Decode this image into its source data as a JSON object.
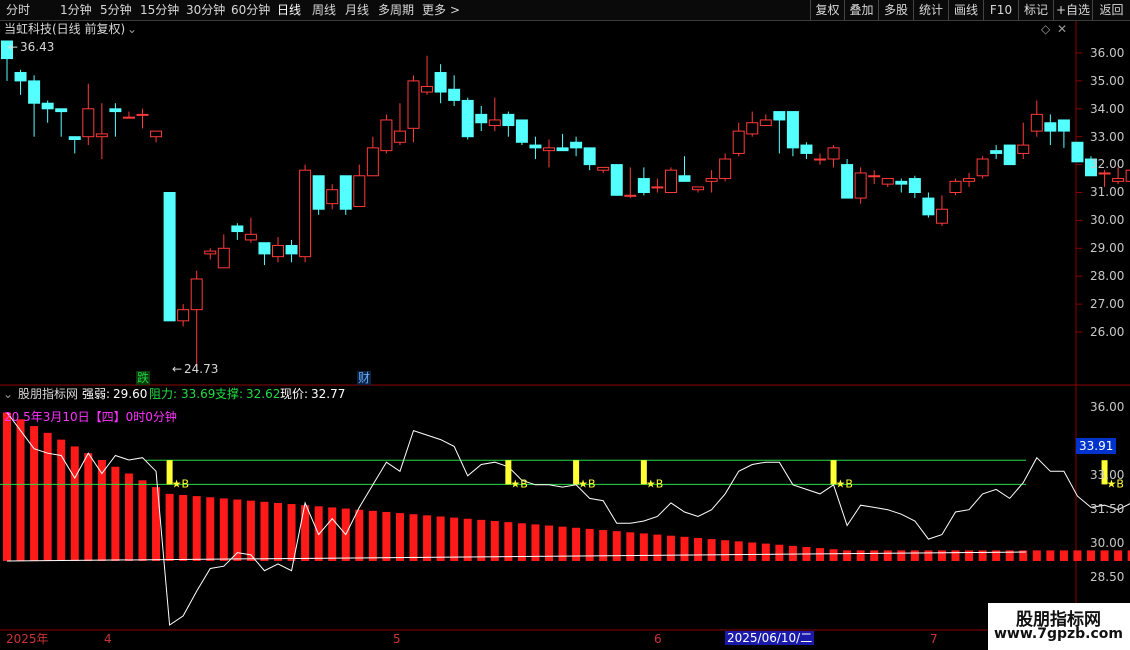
{
  "toolbar": {
    "periods": [
      "分时",
      "1分钟",
      "5分钟",
      "15分钟",
      "30分钟",
      "60分钟",
      "日线",
      "周线",
      "月线",
      "多周期",
      "更多"
    ],
    "more_arrow": ">",
    "right_buttons": [
      "复权",
      "叠加",
      "多股",
      "统计",
      "画线",
      "F10",
      "+自选",
      "返回"
    ],
    "right_buttons_highlight": [
      "标记"
    ]
  },
  "main_chart": {
    "title": "当虹科技(日线 前复权)",
    "high_label": "36.43",
    "low_label": "24.73",
    "low_arrow": "←",
    "high_arrow": "←",
    "axis_ticks": [
      "36.00",
      "35.00",
      "34.00",
      "33.00",
      "32.00",
      "31.00",
      "30.00",
      "29.00",
      "28.00",
      "27.00",
      "26.00"
    ],
    "markers": [
      {
        "text": "跌",
        "color": "#22cc44"
      },
      {
        "text": "财",
        "color": "#66aaff"
      }
    ],
    "up_color": "#ff3a3a",
    "down_color": "#54ffff",
    "candles": [
      [
        36.43,
        35.8,
        36.43,
        35.0
      ],
      [
        35.3,
        35.0,
        35.4,
        34.5
      ],
      [
        35.0,
        34.2,
        35.2,
        33.0
      ],
      [
        34.2,
        34.0,
        34.3,
        33.5
      ],
      [
        34.0,
        33.9,
        34.0,
        33.0
      ],
      [
        33.0,
        32.9,
        33.0,
        32.4
      ],
      [
        33.0,
        34.0,
        34.9,
        32.7
      ],
      [
        33.0,
        33.1,
        34.2,
        32.2
      ],
      [
        34.0,
        33.9,
        34.2,
        33.0
      ],
      [
        33.7,
        33.7,
        33.9,
        33.7
      ],
      [
        33.8,
        33.8,
        34.0,
        33.3
      ],
      [
        33.0,
        33.2,
        33.2,
        32.8
      ],
      [
        31.0,
        26.4,
        31.0,
        26.4
      ],
      [
        26.4,
        26.8,
        27.0,
        26.2
      ],
      [
        26.8,
        27.9,
        28.2,
        24.73
      ],
      [
        28.8,
        28.9,
        29.0,
        28.6
      ],
      [
        28.3,
        29.0,
        29.5,
        28.3
      ],
      [
        29.8,
        29.6,
        29.9,
        29.3
      ],
      [
        29.3,
        29.5,
        30.1,
        29.2
      ],
      [
        29.2,
        28.8,
        29.2,
        28.4
      ],
      [
        28.7,
        29.1,
        29.4,
        28.5
      ],
      [
        29.1,
        28.8,
        29.3,
        28.5
      ],
      [
        28.7,
        31.8,
        32.0,
        28.5
      ],
      [
        31.6,
        30.4,
        31.6,
        30.2
      ],
      [
        30.6,
        31.1,
        31.3,
        30.4
      ],
      [
        31.6,
        30.4,
        31.6,
        30.2
      ],
      [
        30.5,
        31.6,
        32.0,
        30.5
      ],
      [
        31.6,
        32.6,
        33.0,
        31.6
      ],
      [
        32.5,
        33.6,
        33.8,
        32.4
      ],
      [
        32.8,
        33.2,
        34.2,
        32.7
      ],
      [
        33.3,
        35.0,
        35.2,
        32.8
      ],
      [
        34.6,
        34.8,
        35.9,
        34.5
      ],
      [
        35.3,
        34.6,
        35.6,
        34.2
      ],
      [
        34.7,
        34.3,
        35.2,
        34.1
      ],
      [
        34.3,
        33.0,
        34.4,
        32.9
      ],
      [
        33.8,
        33.5,
        34.1,
        33.2
      ],
      [
        33.4,
        33.6,
        34.4,
        33.2
      ],
      [
        33.8,
        33.4,
        33.9,
        33.0
      ],
      [
        33.6,
        32.8,
        33.6,
        32.7
      ],
      [
        32.7,
        32.6,
        33.0,
        32.2
      ],
      [
        32.5,
        32.6,
        32.9,
        31.9
      ],
      [
        32.6,
        32.5,
        33.1,
        32.5
      ],
      [
        32.8,
        32.6,
        33.0,
        32.3
      ],
      [
        32.6,
        32.0,
        32.6,
        31.8
      ],
      [
        31.8,
        31.9,
        31.9,
        31.7
      ],
      [
        32.0,
        30.9,
        32.0,
        30.9
      ],
      [
        30.9,
        30.9,
        31.9,
        30.8
      ],
      [
        31.5,
        31.0,
        31.9,
        30.9
      ],
      [
        31.2,
        31.2,
        31.5,
        31.0
      ],
      [
        31.0,
        31.8,
        31.9,
        31.0
      ],
      [
        31.6,
        31.4,
        32.3,
        31.4
      ],
      [
        31.1,
        31.2,
        31.2,
        31.0
      ],
      [
        31.4,
        31.5,
        31.8,
        31.0
      ],
      [
        31.5,
        32.2,
        32.4,
        31.4
      ],
      [
        32.4,
        33.2,
        33.5,
        32.3
      ],
      [
        33.1,
        33.5,
        33.9,
        33.0
      ],
      [
        33.4,
        33.6,
        33.8,
        33.4
      ],
      [
        33.9,
        33.6,
        33.9,
        32.4
      ],
      [
        33.9,
        32.6,
        33.9,
        32.3
      ],
      [
        32.7,
        32.4,
        32.8,
        32.2
      ],
      [
        32.2,
        32.2,
        32.4,
        32.0
      ],
      [
        32.2,
        32.6,
        32.7,
        31.9
      ],
      [
        32.0,
        30.8,
        32.2,
        30.8
      ],
      [
        30.8,
        31.7,
        31.9,
        30.6
      ],
      [
        31.6,
        31.6,
        31.8,
        31.3
      ],
      [
        31.3,
        31.5,
        31.5,
        31.2
      ],
      [
        31.4,
        31.3,
        31.5,
        31.0
      ],
      [
        31.5,
        31.0,
        31.6,
        30.8
      ],
      [
        30.8,
        30.2,
        31.0,
        30.1
      ],
      [
        29.9,
        30.4,
        30.9,
        29.8
      ],
      [
        31.0,
        31.4,
        31.5,
        30.9
      ],
      [
        31.4,
        31.5,
        31.7,
        31.2
      ],
      [
        31.6,
        32.2,
        32.3,
        31.5
      ],
      [
        32.5,
        32.4,
        32.7,
        32.2
      ],
      [
        32.7,
        32.0,
        32.7,
        32.0
      ],
      [
        32.4,
        32.7,
        33.5,
        32.2
      ],
      [
        33.2,
        33.8,
        34.3,
        33.0
      ],
      [
        33.5,
        33.2,
        33.8,
        32.7
      ],
      [
        33.6,
        33.2,
        33.6,
        32.6
      ],
      [
        32.8,
        32.1,
        32.8,
        32.1
      ],
      [
        32.2,
        31.6,
        32.3,
        31.6
      ],
      [
        31.7,
        31.7,
        31.8,
        31.2
      ],
      [
        31.4,
        31.5,
        31.9,
        31.3
      ],
      [
        31.4,
        31.8,
        32.0,
        31.3
      ],
      [
        31.8,
        33.1,
        34.2,
        31.4
      ],
      [
        33.1,
        33.5,
        33.6,
        33.1
      ],
      [
        33.6,
        32.8,
        33.9,
        32.6
      ]
    ]
  },
  "indicator": {
    "name": "股朋指标网",
    "fields": [
      {
        "label": "强弱:",
        "value": "29.60",
        "color": "#ffffff"
      },
      {
        "label": "阻力:",
        "value": "33.69",
        "color": "#22dd44"
      },
      {
        "label": "支撑:",
        "value": "32.62",
        "color": "#22dd44"
      },
      {
        "label": "现价:",
        "value": "32.77",
        "color": "#ffffff"
      }
    ],
    "date_label": "20 5年3月10日【四】0时0分钟",
    "axis_ticks": [
      "36.00",
      "33.00",
      "31.50",
      "30.00",
      "28.50"
    ],
    "current_value_tag": "33.91",
    "resistance": 33.69,
    "support": 32.62,
    "buy_label": "B",
    "buy_star": "★",
    "buy_indices": [
      12,
      37,
      42,
      47,
      61,
      81
    ],
    "hollow_label": "★◇"
  },
  "time_axis": {
    "labels": [
      "2025年",
      "4",
      "5",
      "6",
      "7"
    ],
    "highlight_date": "2025/06/10/二"
  },
  "watermark": {
    "title": "股朋指标网",
    "url": "www.7gpzb.com"
  },
  "colors": {
    "background": "#000000",
    "grid": "#8b0000",
    "bar_red": "#ff1a1a",
    "buy_yellow": "#ffff33",
    "line_white": "#ffffff",
    "level_green": "#22dd44",
    "tag_blue": "#0033cc"
  }
}
